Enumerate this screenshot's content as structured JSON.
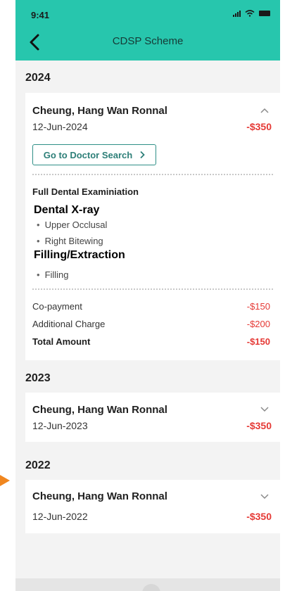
{
  "status_bar": {
    "time": "9:41"
  },
  "header": {
    "title": "CDSP Scheme",
    "back_icon": "chevron-left-icon"
  },
  "colors": {
    "header": "#27c6ad",
    "amount": "#e53935",
    "button": "#2f8f87"
  },
  "records": [
    {
      "year": "2024",
      "name": "Cheung, Hang Wan Ronnal",
      "date": "12-Jun-2024",
      "amount": "-$350",
      "expanded": true,
      "doctor_search_label": "Go to Doctor Search",
      "sections": {
        "exam": "Full Dental Examiniation",
        "xray_title": "Dental X-ray",
        "xray_items": [
          "Upper Occlusal",
          "Right Bitewing"
        ],
        "filling_title": "Filling/Extraction",
        "filling_items": [
          "Filling"
        ]
      },
      "summary": [
        {
          "label": "Co-payment",
          "value": "-$150"
        },
        {
          "label": "Additional Charge",
          "value": "-$200"
        },
        {
          "label": "Total Amount",
          "value": "-$150"
        }
      ]
    },
    {
      "year": "2023",
      "name": "Cheung, Hang Wan Ronnal",
      "date": "12-Jun-2023",
      "amount": "-$350",
      "expanded": false
    },
    {
      "year": "2022",
      "name": "Cheung, Hang Wan Ronnal",
      "date": "12-Jun-2022",
      "amount": "-$350",
      "expanded": false
    }
  ]
}
